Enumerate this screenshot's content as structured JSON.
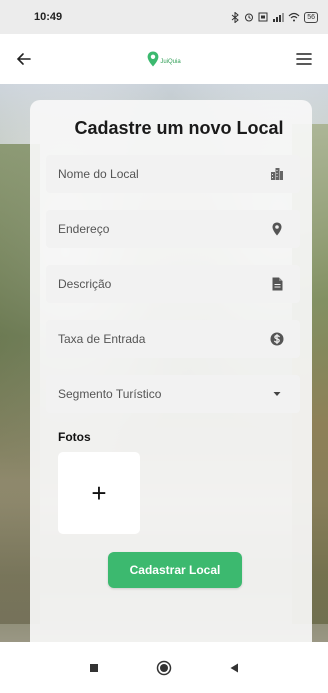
{
  "status_bar": {
    "time": "10:49",
    "battery": "56"
  },
  "app_bar": {
    "logo_text": "JuiQuia"
  },
  "form": {
    "title": "Cadastre um novo Local",
    "fields": [
      {
        "label": "Nome do Local",
        "icon": "building-icon"
      },
      {
        "label": "Endereço",
        "icon": "location-pin-icon"
      },
      {
        "label": "Descrição",
        "icon": "document-icon"
      },
      {
        "label": "Taxa de Entrada",
        "icon": "dollar-coin-icon"
      },
      {
        "label": "Segmento Turístico",
        "icon": "dropdown-arrow-icon"
      }
    ],
    "photos_label": "Fotos",
    "add_photo_symbol": "+",
    "submit_label": "Cadastrar Local"
  },
  "colors": {
    "accent": "#3cb96f",
    "card": "#f8f8f8",
    "field": "#f2f2f2"
  }
}
